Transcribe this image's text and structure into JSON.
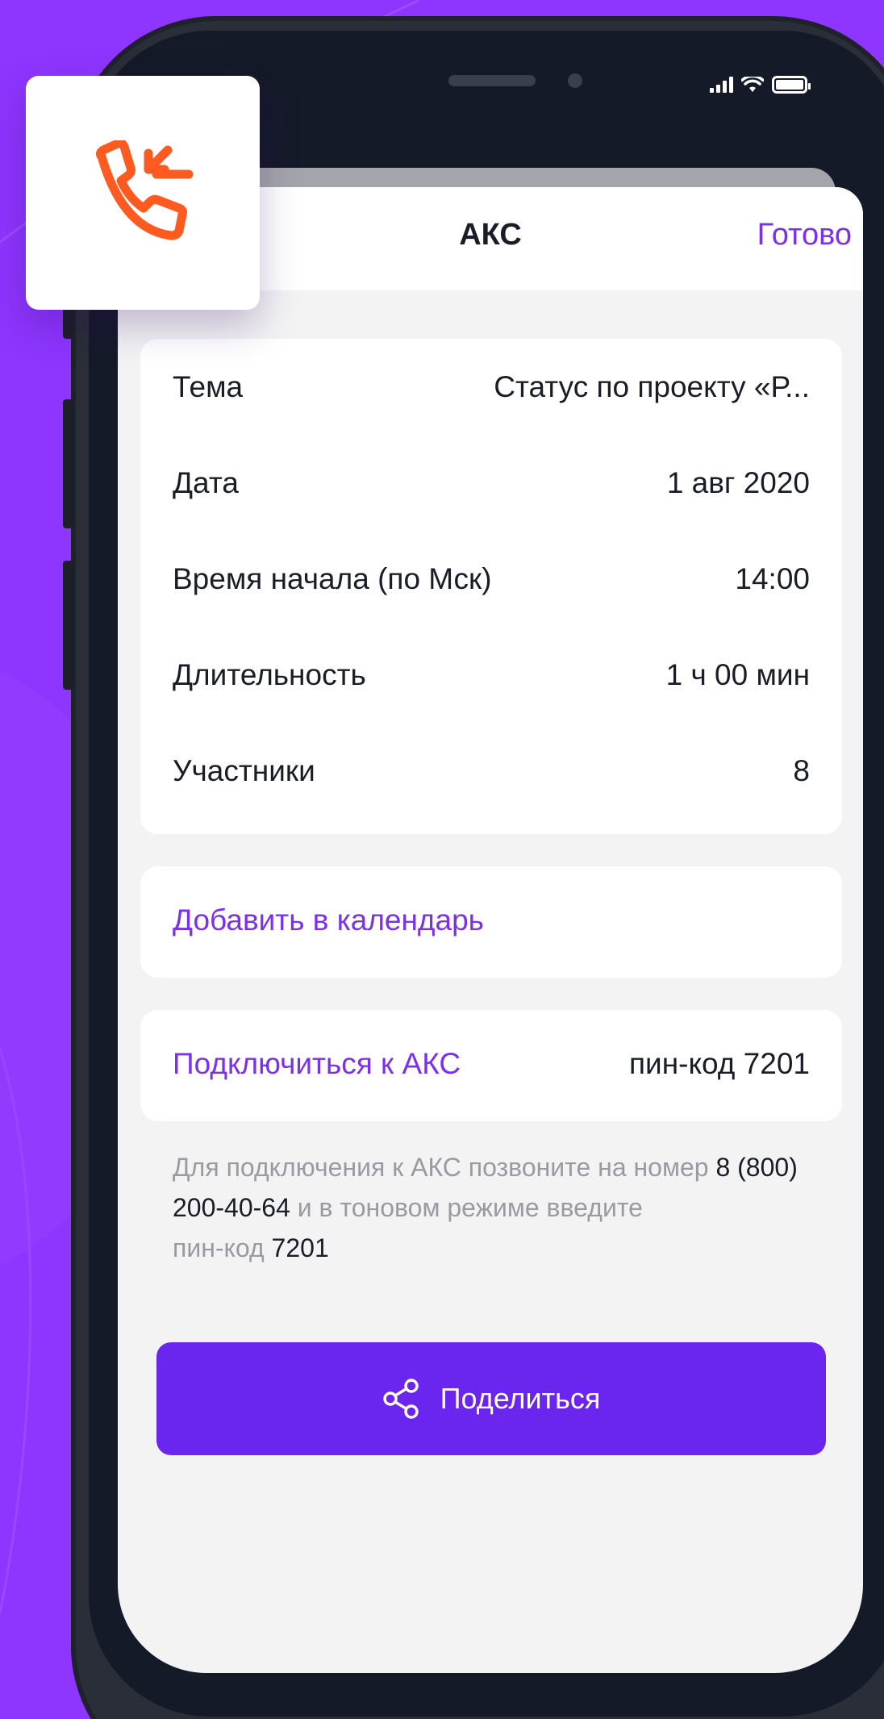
{
  "header": {
    "title": "АКС",
    "done_label": "Готово"
  },
  "details": [
    {
      "label": "Тема",
      "value": "Статус по проекту «Р..."
    },
    {
      "label": "Дата",
      "value": "1 авг 2020"
    },
    {
      "label": "Время начала (по Мск)",
      "value": "14:00"
    },
    {
      "label": "Длительность",
      "value": "1 ч 00 мин"
    },
    {
      "label": "Участники",
      "value": "8"
    }
  ],
  "calendar": {
    "label": "Добавить в календарь"
  },
  "join": {
    "label": "Подключиться к АКС",
    "pin": "пин-код 7201"
  },
  "hint": {
    "part1": "Для подключения к АКС позвоните на номер ",
    "phone": "8 (800) 200-40-64",
    "part2": " и в тоновом режиме введите ",
    "part3": "пин-код ",
    "pin": "7201"
  },
  "share": {
    "label": "Поделиться",
    "icon": "share-icon"
  },
  "badge": {
    "icon": "incoming-call-icon",
    "color": "#ff5a1f"
  },
  "colors": {
    "accent": "#7b2ff0",
    "button": "#6a25ef",
    "background": "#8e35ff"
  }
}
